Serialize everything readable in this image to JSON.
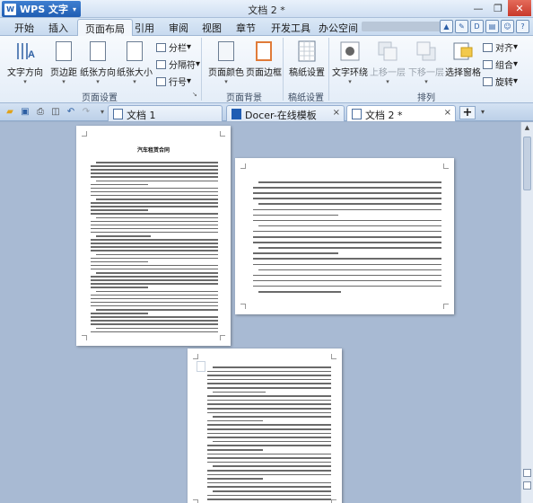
{
  "app": {
    "name": "WPS 文字",
    "document_title": "文档 2 *"
  },
  "menu": {
    "tabs": [
      "开始",
      "插入",
      "页面布局",
      "引用",
      "审阅",
      "视图",
      "章节",
      "开发工具",
      "办公空间"
    ],
    "active": "页面布局"
  },
  "ribbon": {
    "text_direction": "文字方向",
    "margins": "页边距",
    "orientation": "纸张方向",
    "paper_size": "纸张大小",
    "columns": "分栏",
    "breaks": "分隔符",
    "line_numbers": "行号",
    "page_color": "页面颜色",
    "page_border": "页面边框",
    "manuscript": "稿纸设置",
    "text_wrap": "文字环绕",
    "bring_forward": "上移一层",
    "send_backward": "下移一层",
    "selection_pane": "选择窗格",
    "align": "对齐",
    "group": "组合",
    "rotate": "旋转",
    "groups": {
      "page_setup": "页面设置",
      "page_background": "页面背景",
      "manuscript": "稿纸设置",
      "arrange": "排列"
    }
  },
  "doc_tabs": [
    {
      "label": "文档 1",
      "active": false
    },
    {
      "label": "Docer-在线模板",
      "active": false
    },
    {
      "label": "文档 2 *",
      "active": true
    }
  ],
  "add_tab": "+",
  "document": {
    "heading": "汽车租赁合同"
  },
  "colors": {
    "accent": "#1f5db3",
    "workspace": "#a8bad3",
    "ribbon": "#e4edf8"
  }
}
